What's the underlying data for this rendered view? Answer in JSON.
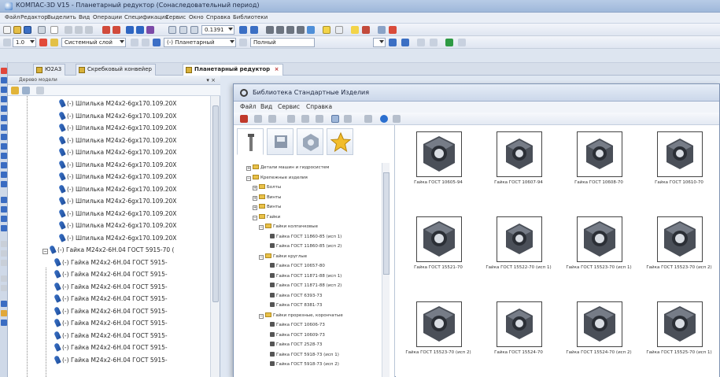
{
  "window": {
    "title": "КОМПАС-3D V15 - Планетарный редуктор (Сонаследовательный период)"
  },
  "menu": [
    "Файл",
    "Редактор",
    "Выделить",
    "Вид",
    "Операции",
    "Спецификация",
    "Сервис",
    "Окно",
    "Справка",
    "Библиотеки"
  ],
  "toolbar": {
    "zoom_value": "0.1391",
    "step_value": "1.0",
    "layer_label": "Системный слой",
    "assembly_label": "(-) Планетарный",
    "view_label": "Полный"
  },
  "doc_tabs": [
    {
      "label": "Ю2А3"
    },
    {
      "label": "Скребковый конвейер"
    },
    {
      "label": "Планетарный редуктор"
    }
  ],
  "tree": {
    "header_label": "Дерево модели",
    "items": [
      "(-) Шпилька М24х2-6gх170.109.20Х",
      "(-) Шпилька М24х2-6gх170.109.20Х",
      "(-) Шпилька М24х2-6gх170.109.20Х",
      "(-) Шпилька М24х2-6gх170.109.20Х",
      "(-) Шпилька М24х2-6gх170.109.20Х",
      "(-) Шпилька М24х2-6gх170.109.20Х",
      "(-) Шпилька М24х2-6gх170.109.20Х",
      "(-) Шпилька М24х2-6gх170.109.20Х",
      "(-) Шпилька М24х2-6gх170.109.20Х",
      "(-) Шпилька М24х2-6gх170.109.20Х",
      "(-) Шпилька М24х2-6gх170.109.20Х",
      "(-) Шпилька М24х2-6gх170.109.20Х",
      "(-) Гайка  М24х2-6Н.04 ГОСТ 5915-70 (",
      "(-) Гайка  М24х2-6Н.04 ГОСТ 5915-",
      "(-) Гайка  М24х2-6Н.04 ГОСТ 5915-",
      "(-) Гайка  М24х2-6Н.04 ГОСТ 5915-",
      "(-) Гайка  М24х2-6Н.04 ГОСТ 5915-",
      "(-) Гайка  М24х2-6Н.04 ГОСТ 5915-",
      "(-) Гайка  М24х2-6Н.04 ГОСТ 5915-",
      "(-) Гайка  М24х2-6Н.04 ГОСТ 5915-",
      "(-) Гайка  М24х2-6Н.04 ГОСТ 5915-",
      "(-) Гайка  М24х2-6Н.04 ГОСТ 5915-"
    ]
  },
  "library": {
    "title": "Библиотека Стандартные Изделия",
    "menu": [
      "Файл",
      "Вид",
      "Сервис",
      "Справка"
    ],
    "categories": [
      {
        "label": "Детали машин и гидросистем",
        "kind": "folder"
      },
      {
        "label": "Крепежные изделия",
        "kind": "folder"
      },
      {
        "label": "Болты",
        "kind": "folder"
      },
      {
        "label": "Винты",
        "kind": "folder"
      },
      {
        "label": "Винты",
        "kind": "folder"
      },
      {
        "label": "Гайки",
        "kind": "folder"
      },
      {
        "label": "Гайки колпачковые",
        "kind": "folder"
      },
      {
        "label": "Гайка ГОСТ 11860-85 (исп 1)",
        "kind": "item"
      },
      {
        "label": "Гайка ГОСТ 11860-85 (исп 2)",
        "kind": "item"
      },
      {
        "label": "Гайки круглые",
        "kind": "folder"
      },
      {
        "label": "Гайка ГОСТ 10657-80",
        "kind": "item"
      },
      {
        "label": "Гайка ГОСТ 11871-88 (исп 1)",
        "kind": "item"
      },
      {
        "label": "Гайка ГОСТ 11871-88 (исп 2)",
        "kind": "item"
      },
      {
        "label": "Гайка ГОСТ 6393-73",
        "kind": "item"
      },
      {
        "label": "Гайка ГОСТ 8381-73",
        "kind": "item"
      },
      {
        "label": "Гайки прорезные, корончатые",
        "kind": "folder"
      },
      {
        "label": "Гайка ГОСТ 10606-73",
        "kind": "item"
      },
      {
        "label": "Гайка ГОСТ 10609-73",
        "kind": "item"
      },
      {
        "label": "Гайка ГОСТ 2528-73",
        "kind": "item"
      },
      {
        "label": "Гайка ГОСТ 5918-73 (исп 1)",
        "kind": "item"
      },
      {
        "label": "Гайка ГОСТ 5918-73 (исп 2)",
        "kind": "item"
      }
    ],
    "grid": [
      {
        "caption": "Гайка ГОСТ 10605-94",
        "style": "hex"
      },
      {
        "caption": "Гайка ГОСТ 10607-94",
        "style": "round"
      },
      {
        "caption": "Гайка ГОСТ 10608-70",
        "style": "round"
      },
      {
        "caption": "Гайка ГОСТ 10610-70",
        "style": "round"
      },
      {
        "caption": "Гайка ГОСТ 15521-70",
        "style": "hex"
      },
      {
        "caption": "Гайка ГОСТ 15522-70 (исп 1)",
        "style": "round"
      },
      {
        "caption": "Гайка ГОСТ 15523-70 (исп 1)",
        "style": "hex"
      },
      {
        "caption": "Гайка ГОСТ 15523-70 (исп 2)",
        "style": "hex"
      },
      {
        "caption": "Гайка ГОСТ 15523-70 (исп 2)",
        "style": "hex"
      },
      {
        "caption": "Гайка ГОСТ 15524-70",
        "style": "round"
      },
      {
        "caption": "Гайка ГОСТ 15524-70 (исп 2)",
        "style": "hex"
      },
      {
        "caption": "Гайка ГОСТ 15525-70 (исп 1)",
        "style": "hex"
      }
    ]
  },
  "colors": {
    "nut_dark": "#4a4f58",
    "nut_light": "#9aa2ae",
    "folder": "#e9c14a",
    "tree_icon": "#2c5fb0"
  }
}
